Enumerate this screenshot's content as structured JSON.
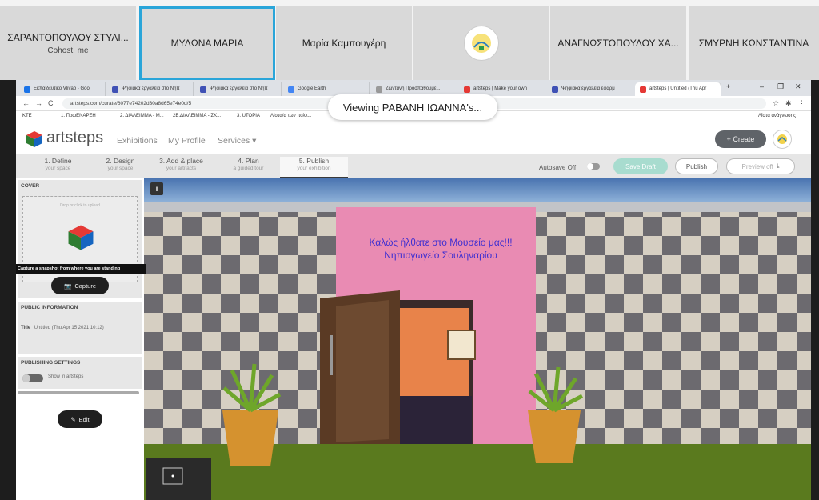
{
  "participants": [
    {
      "name": "ΣΑΡΑΝΤΟΠΟΥΛΟΥ ΣΤΥΛΙ...",
      "sub": "Cohost, me",
      "active": false,
      "logo": false
    },
    {
      "name": "ΜΥΛΩΝΑ ΜΑΡΙΑ",
      "sub": "",
      "active": true,
      "logo": false
    },
    {
      "name": "Μαρία Καμπουγέρη",
      "sub": "",
      "active": false,
      "logo": false
    },
    {
      "name": "",
      "sub": "",
      "active": false,
      "logo": true
    },
    {
      "name": "ΑΝΑΓΝΩΣΤΟΠΟΥΛΟΥ ΧΑ...",
      "sub": "",
      "active": false,
      "logo": false
    },
    {
      "name": "ΣΜΥΡΝΗ ΚΩΝΣΤΑΝΤΙΝΑ",
      "sub": "",
      "active": false,
      "logo": false
    }
  ],
  "viewing_toast": "Viewing ΡΑΒΑΝΗ ΙΩΑΝΝΑ's...",
  "browser": {
    "tabs": [
      {
        "title": "Εκπαιδευτικό Vlivab - Goo",
        "color": "#1a73e8"
      },
      {
        "title": "Ψηφιακά εργαλεία στο Νηπ",
        "color": "#3f51b5"
      },
      {
        "title": "Ψηφιακά εργαλεία στο Νηπ",
        "color": "#3f51b5"
      },
      {
        "title": "Google Earth",
        "color": "#4285f4"
      },
      {
        "title": "Ζωντανή Προσπαθούμε...",
        "color": "#999999"
      },
      {
        "title": "artsteps | Make your own",
        "color": "#e53935"
      },
      {
        "title": "Ψηφιακά εργαλεία εφαρμ",
        "color": "#3f51b5"
      },
      {
        "title": "artsteps | Untitled (Thu Apr",
        "color": "#e53935"
      }
    ],
    "new_tab": "+",
    "window_controls": [
      "–",
      "❐",
      "✕"
    ],
    "url": "artsteps.com/curate/6077e74202d30a8d65e74e0d/5",
    "nav_icons": [
      "←",
      "→",
      "C"
    ],
    "bookmarks": [
      "ΚΤΕ",
      "1. ΠρωΕΝΑΡΞΗ",
      "2. ΔΙΑΛΕΙΜΜΑ - Μ...",
      "2Β.ΔΙΑΛΕΙΜΜΑ - ΣΚ...",
      "3. UTOPIA",
      "Λίστα/α των πολλ..."
    ],
    "reading_list": "Λίστα ανάγνωσης"
  },
  "app": {
    "logo": "artsteps",
    "nav": [
      "Exhibitions",
      "My Profile",
      "Services ▾"
    ],
    "create": "+ Create",
    "steps": [
      {
        "title": "1. Define",
        "sub": "your space"
      },
      {
        "title": "2. Design",
        "sub": "your space"
      },
      {
        "title": "3. Add & place",
        "sub": "your artifacts"
      },
      {
        "title": "4. Plan",
        "sub": "a guided tour"
      },
      {
        "title": "5. Publish",
        "sub": "your exhibition"
      }
    ],
    "current_step": 4,
    "autosave": "Autosave Off",
    "save_draft": "Save Draft",
    "publish": "Publish",
    "preview": "Preview off"
  },
  "panel": {
    "cover_header": "COVER",
    "drop_hint": "Drop or click to upload",
    "tooltip": "Capture a snapshot from where you are standing",
    "capture": "Capture",
    "public_header": "PUBLIC INFORMATION",
    "title_label": "Title",
    "title_value": "Untitled (Thu Apr 15 2021 10:12)",
    "edit": "Edit",
    "publishing_header": "PUBLISHING SETTINGS",
    "show_label": "Show in artsteps"
  },
  "scene": {
    "info": "i",
    "welcome_line1": "Καλώς ήλθατε στο Μουσείο μας!!!",
    "welcome_line2": "Νηπιαγωγείο Σουληναρίου"
  },
  "colors": {
    "active_border": "#2aa5d9",
    "welcome_text": "#3f2fd1",
    "wall_pink": "#e98bb3",
    "floor": "#5a7a1e"
  }
}
